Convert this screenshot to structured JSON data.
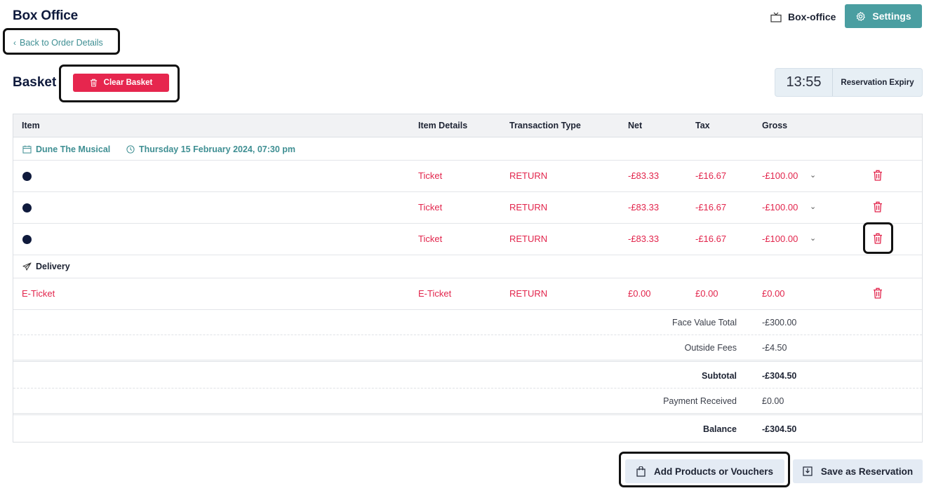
{
  "header": {
    "title": "Box Office",
    "boxoffice_label": "Box-office",
    "settings_label": "Settings",
    "back_label": "Back to Order Details"
  },
  "basket": {
    "title": "Basket",
    "clear_label": "Clear Basket",
    "timer": "13:55",
    "timer_label": "Reservation Expiry"
  },
  "table": {
    "columns": [
      "Item",
      "Item Details",
      "Transaction Type",
      "Net",
      "Tax",
      "Gross"
    ],
    "event": {
      "name": "Dune The Musical",
      "date": "Thursday 15 February 2024, 07:30 pm"
    },
    "ticket_rows": [
      {
        "details": "Ticket",
        "type": "RETURN",
        "net": "-£83.33",
        "tax": "-£16.67",
        "gross": "-£100.00"
      },
      {
        "details": "Ticket",
        "type": "RETURN",
        "net": "-£83.33",
        "tax": "-£16.67",
        "gross": "-£100.00"
      },
      {
        "details": "Ticket",
        "type": "RETURN",
        "net": "-£83.33",
        "tax": "-£16.67",
        "gross": "-£100.00"
      }
    ],
    "delivery_label": "Delivery",
    "delivery_row": {
      "item": "E-Ticket",
      "details": "E-Ticket",
      "type": "RETURN",
      "net": "£0.00",
      "tax": "£0.00",
      "gross": "£0.00"
    }
  },
  "summary": {
    "face_value_label": "Face Value Total",
    "face_value": "-£300.00",
    "outside_fees_label": "Outside Fees",
    "outside_fees": "-£4.50",
    "subtotal_label": "Subtotal",
    "subtotal": "-£304.50",
    "payment_label": "Payment Received",
    "payment": "£0.00",
    "balance_label": "Balance",
    "balance": "-£304.50"
  },
  "actions": {
    "add_label": "Add Products or Vouchers",
    "save_label": "Save as Reservation"
  },
  "colors": {
    "accent": "#4a9ea1",
    "danger": "#e6264e",
    "navy": "#0f1a3c"
  }
}
